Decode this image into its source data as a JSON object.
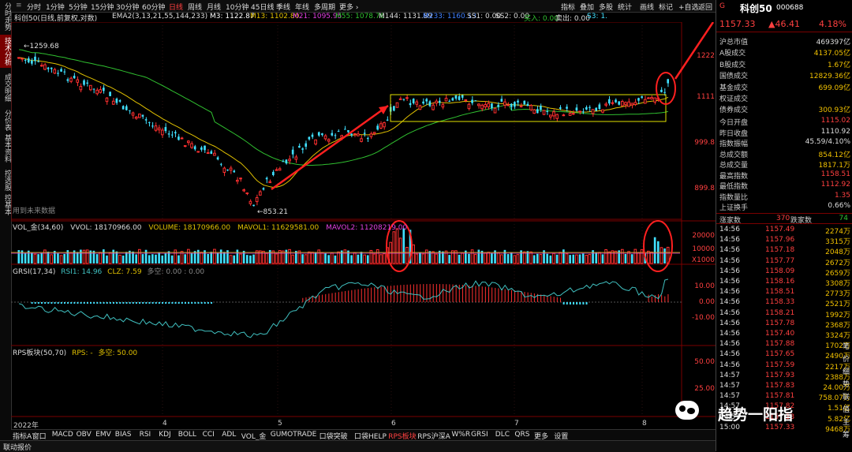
{
  "left_tabs": [
    "分时走势",
    "技术分析",
    "成交明细",
    "分价表",
    "基本资料",
    "控选股",
    "控基本"
  ],
  "top_tabs": [
    "分时",
    "1分钟",
    "5分钟",
    "15分钟",
    "30分钟",
    "60分钟",
    "日线",
    "周线",
    "月线",
    "10分钟",
    "45日线",
    "季线",
    "年线",
    "多周期",
    "更多 ›"
  ],
  "top_tools": [
    "指标",
    "叠加",
    "多股",
    "统计",
    "画线",
    "标记",
    "+自选",
    "返回"
  ],
  "indicator_line": {
    "name": "科创50(日线,前复权,对数)",
    "ema": "EMA2(3,13,21,55,144,233)",
    "m3": "M3: 1122.87",
    "m13": "M13: 1102.80",
    "m21": "M21: 1095.95",
    "m55": "M55: 1078.76",
    "m144": "M144: 1131.89",
    "m233": "M233: 1160.13",
    "ss1": "SS1: 0.00",
    "ss2": "SS2: 0.00",
    "buy": "买入: 0.00",
    "sell": "卖出: 0.00",
    "s3": "S3: 1."
  },
  "price_annotations": {
    "high": "1259.68",
    "low": "853.21",
    "future": "用到未来数据"
  },
  "price_axis": [
    "1222",
    "1111",
    "999.8",
    "899.8"
  ],
  "vol_line": {
    "name": "VOL_金(34,60)",
    "vvol": "VVOL: 18170966.00",
    "volume": "VOLUME: 18170966.00",
    "mavol1": "MAVOL1: 11629581.00",
    "mavol2": "MAVOL2: 11208219.00"
  },
  "vol_axis": [
    "20000",
    "10000",
    "X1000"
  ],
  "grsi_line": {
    "name": "GRSI(17,34)",
    "rsi1": "RSI1: 14.96",
    "clz": "CLZ: 7.59",
    "duokong": "多空: 0.00 : 0.00"
  },
  "grsi_axis": [
    "10.00",
    "0.00",
    "-10.00"
  ],
  "rps_line": {
    "name": "RPS板块(50,70)",
    "rps": "RPS: -",
    "duokong": "多空: 50.00"
  },
  "rps_axis": [
    "50.00",
    "25.00"
  ],
  "x_axis": [
    "2022年",
    "4",
    "5",
    "6",
    "7",
    "8"
  ],
  "bottom_tabs": [
    "指标A",
    "窗口",
    "MACD",
    "OBV",
    "EMV",
    "BIAS",
    "RSI",
    "KDJ",
    "BOLL",
    "CCI",
    "ADL",
    "VOL_金",
    "GUMOTRADE",
    "口袋突破",
    "口袋HELP",
    "RPS板块",
    "RPS沪深A",
    "W%R",
    "GRSI",
    "DLC",
    "QRS",
    "更多",
    "设置"
  ],
  "status_text": "联动报价",
  "stock": {
    "name": "科创50",
    "code": "000688",
    "price": "1157.33",
    "change": "▲46.41",
    "pct": "4.18%"
  },
  "metrics": [
    {
      "k": "沪总市值",
      "v": "469397亿",
      "c": "#ddd"
    },
    {
      "k": "A股成交",
      "v": "4137.05亿",
      "c": "#f0c000"
    },
    {
      "k": "B股成交",
      "v": "1.67亿",
      "c": "#f0c000"
    },
    {
      "k": "国债成交",
      "v": "12829.36亿",
      "c": "#f0c000"
    },
    {
      "k": "基金成交",
      "v": "699.09亿",
      "c": "#f0c000"
    },
    {
      "k": "权证成交",
      "v": "",
      "c": "#f0c000"
    },
    {
      "k": "债券成交",
      "v": "300.93亿",
      "c": "#f0c000"
    },
    {
      "k": "今日开盘",
      "v": "1115.02",
      "c": "#ff4040"
    },
    {
      "k": "昨日收盘",
      "v": "1110.92",
      "c": "#ddd"
    },
    {
      "k": "指数振幅",
      "v": "45.59/4.10%",
      "c": "#ddd"
    },
    {
      "k": "总成交额",
      "v": "854.12亿",
      "c": "#f0c000"
    },
    {
      "k": "总成交量",
      "v": "1817.1万",
      "c": "#f0c000"
    },
    {
      "k": "最高指数",
      "v": "1158.51",
      "c": "#ff4040"
    },
    {
      "k": "最低指数",
      "v": "1112.92",
      "c": "#ff4040"
    },
    {
      "k": "指数量比",
      "v": "1.35",
      "c": "#ff4040"
    },
    {
      "k": "上证换手",
      "v": "0.66%",
      "c": "#ddd"
    }
  ],
  "updown": {
    "up_label": "涨家数",
    "up": "370",
    "down_label": "跌家数",
    "down": "74"
  },
  "ticks": [
    {
      "t": "14:56",
      "p": "1157.49",
      "v": "2274万"
    },
    {
      "t": "14:56",
      "p": "1157.96",
      "v": "3315万"
    },
    {
      "t": "14:56",
      "p": "1157.18",
      "v": "2048万"
    },
    {
      "t": "14:56",
      "p": "1157.77",
      "v": "2672万"
    },
    {
      "t": "14:56",
      "p": "1158.09",
      "v": "2659万"
    },
    {
      "t": "14:56",
      "p": "1158.16",
      "v": "3308万"
    },
    {
      "t": "14:56",
      "p": "1158.51",
      "v": "2773万"
    },
    {
      "t": "14:56",
      "p": "1158.33",
      "v": "2521万"
    },
    {
      "t": "14:56",
      "p": "1158.21",
      "v": "1992万"
    },
    {
      "t": "14:56",
      "p": "1157.78",
      "v": "2368万"
    },
    {
      "t": "14:56",
      "p": "1157.40",
      "v": "3324万"
    },
    {
      "t": "14:56",
      "p": "1157.88",
      "v": "1702万"
    },
    {
      "t": "14:56",
      "p": "1157.65",
      "v": "2490万"
    },
    {
      "t": "14:56",
      "p": "1157.59",
      "v": "2217万"
    },
    {
      "t": "14:57",
      "p": "1157.93",
      "v": "2388万"
    },
    {
      "t": "14:57",
      "p": "1157.83",
      "v": "24.00万"
    },
    {
      "t": "14:57",
      "p": "1157.81",
      "v": "758.07万"
    },
    {
      "t": "14:57",
      "p": "1157.82",
      "v": "1.51亿"
    },
    {
      "t": "14:57",
      "p": "1157.33",
      "v": "5.82亿"
    },
    {
      "t": "15:00",
      "p": "1157.33",
      "v": "9468万"
    }
  ],
  "watermark": "趋势一阳指",
  "right_bottom": [
    "笔",
    "价",
    "细",
    "势",
    "联",
    "值",
    "主",
    "筹"
  ],
  "colors": {
    "up": "#ff3030",
    "down": "#40e0ff",
    "ema13": "#e0c000",
    "ema55": "#30c030",
    "box": "#e0e000",
    "circle": "#ff2020"
  }
}
